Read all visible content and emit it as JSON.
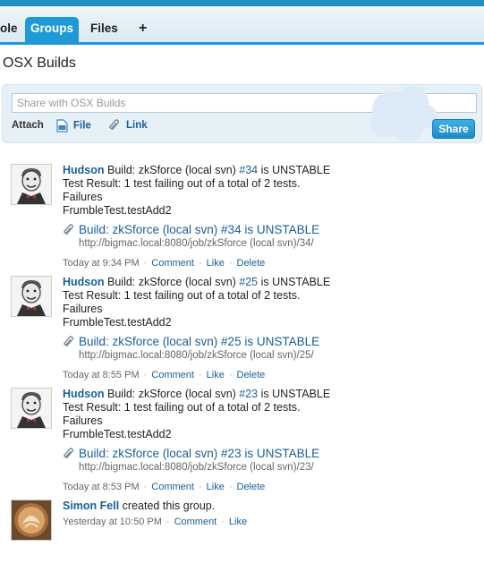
{
  "tabs": {
    "partial": "ole",
    "groups": "Groups",
    "files": "Files",
    "add": "+"
  },
  "page_title": "OSX Builds",
  "publisher": {
    "placeholder": "Share with OSX Builds",
    "attach_label": "Attach",
    "file_label": "File",
    "link_label": "Link",
    "share_label": "Share"
  },
  "feed": [
    {
      "author": "Hudson",
      "text_pre": " Build: zkSforce (local svn) ",
      "build_link": "#34",
      "text_post": " is UNSTABLE",
      "line2": "Test Result: 1 test failing out of a total of 2 tests.",
      "line3": "Failures",
      "line4": "FrumbleTest.testAdd2",
      "link_title": "Build: zkSforce (local svn) #34 is UNSTABLE",
      "link_url": "http://bigmac.local:8080/job/zkSforce (local svn)/34/",
      "time": "Today at 9:34 PM",
      "comment": "Comment",
      "like": "Like",
      "delete": "Delete"
    },
    {
      "author": "Hudson",
      "text_pre": " Build: zkSforce (local svn) ",
      "build_link": "#25",
      "text_post": " is UNSTABLE",
      "line2": "Test Result: 1 test failing out of a total of 2 tests.",
      "line3": "Failures",
      "line4": "FrumbleTest.testAdd2",
      "link_title": "Build: zkSforce (local svn) #25 is UNSTABLE",
      "link_url": "http://bigmac.local:8080/job/zkSforce (local svn)/25/",
      "time": "Today at 8:55 PM",
      "comment": "Comment",
      "like": "Like",
      "delete": "Delete"
    },
    {
      "author": "Hudson",
      "text_pre": " Build: zkSforce (local svn) ",
      "build_link": "#23",
      "text_post": " is UNSTABLE",
      "line2": "Test Result: 1 test failing out of a total of 2 tests.",
      "line3": "Failures",
      "line4": "FrumbleTest.testAdd2",
      "link_title": "Build: zkSforce (local svn) #23 is UNSTABLE",
      "link_url": "http://bigmac.local:8080/job/zkSforce (local svn)/23/",
      "time": "Today at 8:53 PM",
      "comment": "Comment",
      "like": "Like",
      "delete": "Delete"
    }
  ],
  "group_created": {
    "author": "Simon Fell",
    "text": " created this group.",
    "time": "Yesterday at 10:50 PM",
    "comment": "Comment",
    "like": "Like"
  },
  "colors": {
    "accent": "#1f9ad6",
    "link": "#1a5e9a",
    "publisher_bg": "#e6f0f7"
  }
}
